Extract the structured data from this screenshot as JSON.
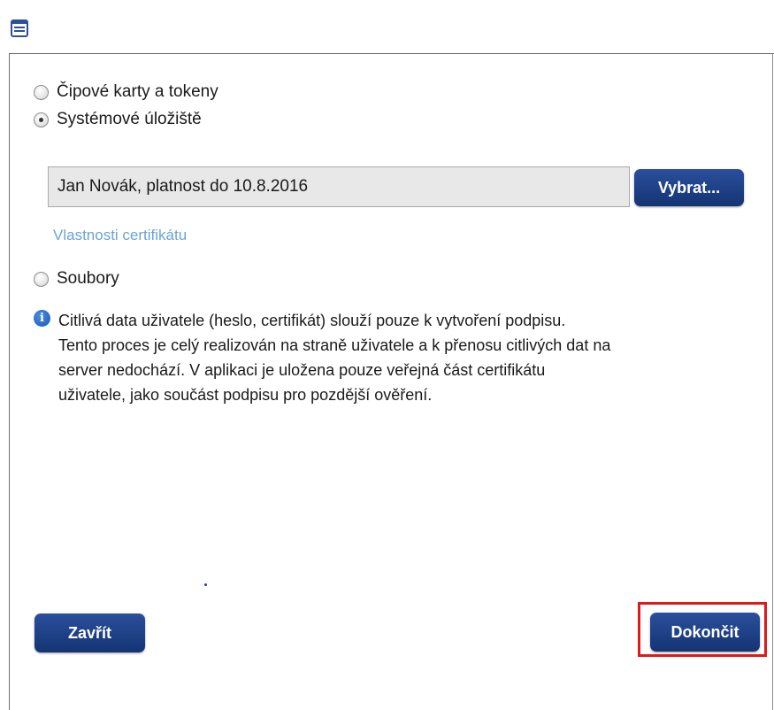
{
  "window": {
    "icon": "form-window-icon"
  },
  "options": [
    {
      "label": "Čipové karty a tokeny",
      "checked": false
    },
    {
      "label": "Systémové úložiště",
      "checked": true
    },
    {
      "label": "Soubory",
      "checked": false
    }
  ],
  "certificate": {
    "value": "Jan Novák, platnost do 10.8.2016",
    "select_label": "Vybrat...",
    "properties_link": "Vlastnosti certifikátu"
  },
  "info": {
    "icon": "info-icon",
    "lines": [
      "Citlivá data uživatele (heslo, certifikát) slouží pouze k vytvoření podpisu.",
      "Tento proces je celý realizován na straně uživatele a k přenosu citlivých dat na",
      "server nedochází. V aplikaci je uložena pouze veřejná část certifikátu",
      "uživatele, jako součást podpisu pro pozdější ověření."
    ]
  },
  "buttons": {
    "close": "Zavřít",
    "finish": "Dokončit"
  },
  "colors": {
    "button": "#1c3f87",
    "link": "#6aa3d6",
    "highlight": "#e01919"
  }
}
